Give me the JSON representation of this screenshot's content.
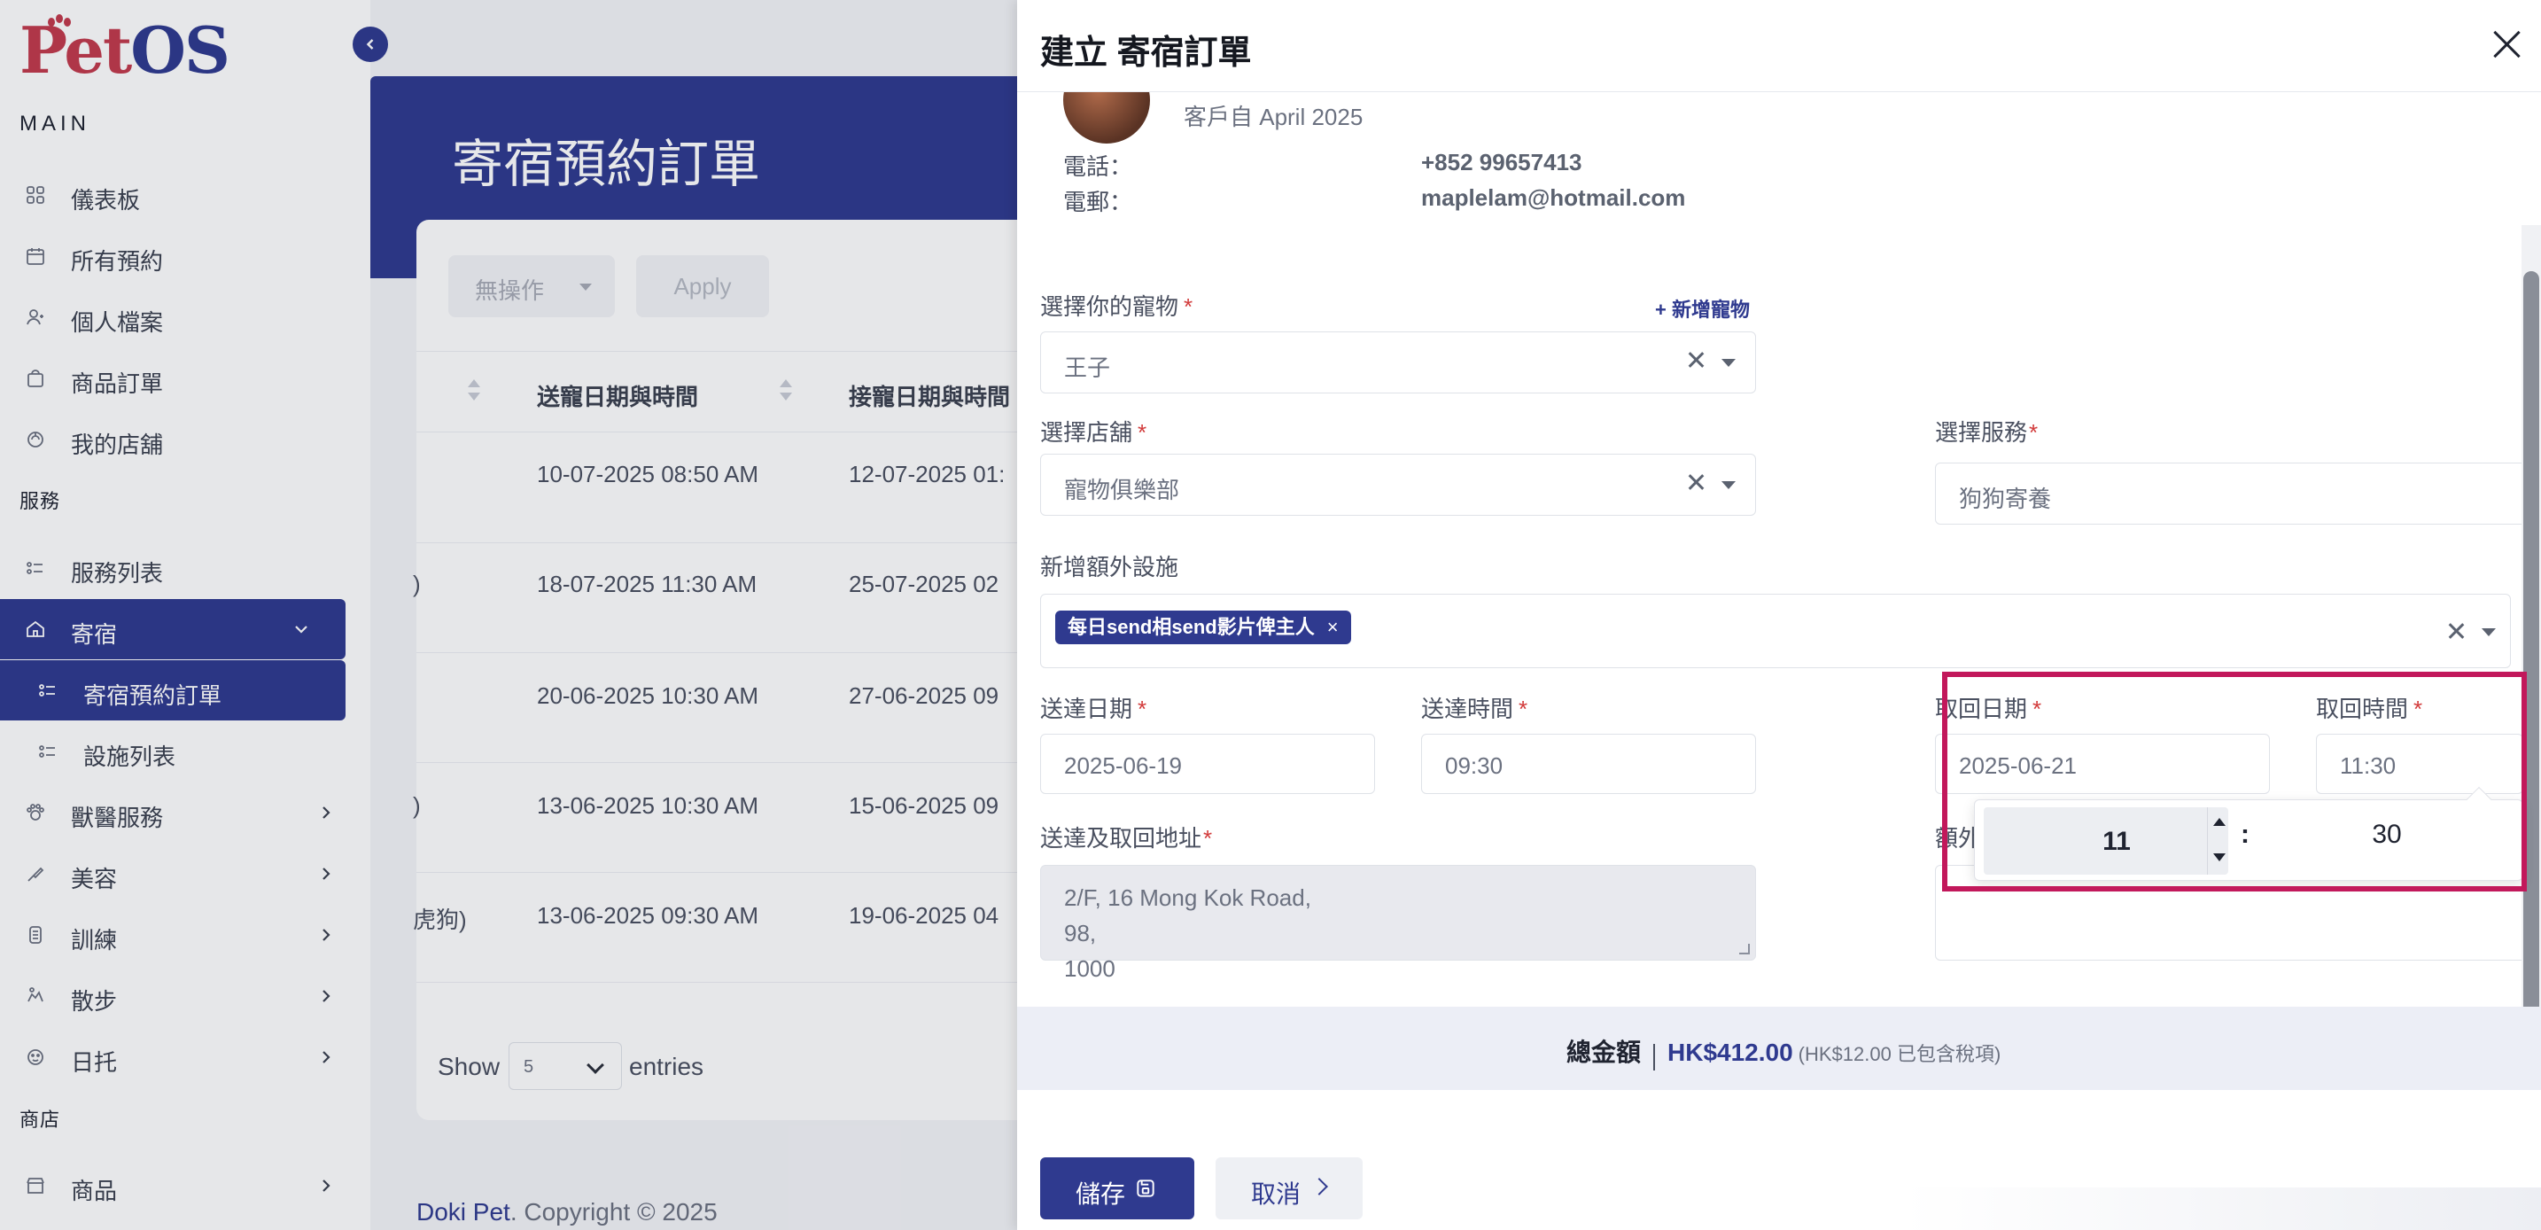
{
  "app": {
    "logo_p": "P",
    "logo_et": "et",
    "logo_os": "OS"
  },
  "sidebar": {
    "section_main": "MAIN",
    "section_services": "服務",
    "section_shop": "商店",
    "items": [
      {
        "label": "儀表板",
        "icon": "dashboard-icon"
      },
      {
        "label": "所有預約",
        "icon": "calendar-icon"
      },
      {
        "label": "個人檔案",
        "icon": "user-icon"
      },
      {
        "label": "商品訂單",
        "icon": "bag-icon"
      },
      {
        "label": "我的店舖",
        "icon": "store-icon"
      },
      {
        "label": "服務列表",
        "icon": "list-icon"
      },
      {
        "label": "寄宿",
        "icon": "home-icon"
      },
      {
        "label": "寄宿預約訂單",
        "icon": "list-icon"
      },
      {
        "label": "設施列表",
        "icon": "list-icon"
      },
      {
        "label": "獸醫服務",
        "icon": "paw-icon"
      },
      {
        "label": "美容",
        "icon": "brush-icon"
      },
      {
        "label": "訓練",
        "icon": "leash-icon"
      },
      {
        "label": "散步",
        "icon": "walk-icon"
      },
      {
        "label": "日托",
        "icon": "daycare-icon"
      },
      {
        "label": "商品",
        "icon": "shop-icon"
      }
    ]
  },
  "main": {
    "page_title": "寄宿預約訂單",
    "bulk_action": "無操作",
    "apply_label": "Apply",
    "columns": [
      "送寵日期與時間",
      "接寵日期與時間"
    ],
    "rows": [
      {
        "prefix": "",
        "dropoff": "10-07-2025 08:50 AM",
        "pickup": "12-07-2025 01:"
      },
      {
        "prefix": ")",
        "dropoff": "18-07-2025 11:30 AM",
        "pickup": "25-07-2025 02"
      },
      {
        "prefix": "",
        "dropoff": "20-06-2025 10:30 AM",
        "pickup": "27-06-2025 09"
      },
      {
        "prefix": ")",
        "dropoff": "13-06-2025 10:30 AM",
        "pickup": "15-06-2025 09"
      },
      {
        "prefix": "虎狗)",
        "dropoff": "13-06-2025 09:30 AM",
        "pickup": "19-06-2025 04"
      }
    ],
    "show_label": "Show",
    "show_value": "5",
    "entries_label": "entries",
    "footer_brand": "Doki Pet",
    "footer_copyright": ". Copyright © 2025"
  },
  "drawer": {
    "title": "建立 寄宿訂單",
    "customer": {
      "since": "客戶自 April 2025",
      "phone_label": "電話：",
      "phone": "+852 99657413",
      "email_label": "電郵：",
      "email": "maplelam@hotmail.com"
    },
    "pet": {
      "label": "選擇你的寵物",
      "value": "王子",
      "add_label": "+ 新增寵物"
    },
    "store": {
      "label": "選擇店舖",
      "value": "寵物俱樂部"
    },
    "service": {
      "label": "選擇服務",
      "value": "狗狗寄養"
    },
    "facilities": {
      "label": "新增額外設施",
      "tag": "每日send相send影片俾主人"
    },
    "dropoff_date": {
      "label": "送達日期",
      "value": "2025-06-19"
    },
    "dropoff_time": {
      "label": "送達時間",
      "value": "09:30"
    },
    "pickup_date": {
      "label": "取回日期",
      "value": "2025-06-21"
    },
    "pickup_time": {
      "label": "取回時間",
      "value": "11:30"
    },
    "time_picker": {
      "hour": "11",
      "separator": ":",
      "minute": "30"
    },
    "address": {
      "label": "送達及取回地址",
      "value": "2/F, 16 Mong Kok Road,\n98,\n1000"
    },
    "extra_info": {
      "label": "額外資訊",
      "value": ""
    },
    "total": {
      "label": "總金額",
      "amount": "HK$412.00",
      "tax_note": "(HK$12.00 已包含稅項)"
    },
    "save_label": "儲存",
    "cancel_label": "取消"
  },
  "colors": {
    "brand": "#2f3a8f",
    "logo_red": "#c23a4c",
    "required": "#d23a3a",
    "highlight": "#c2185b"
  }
}
